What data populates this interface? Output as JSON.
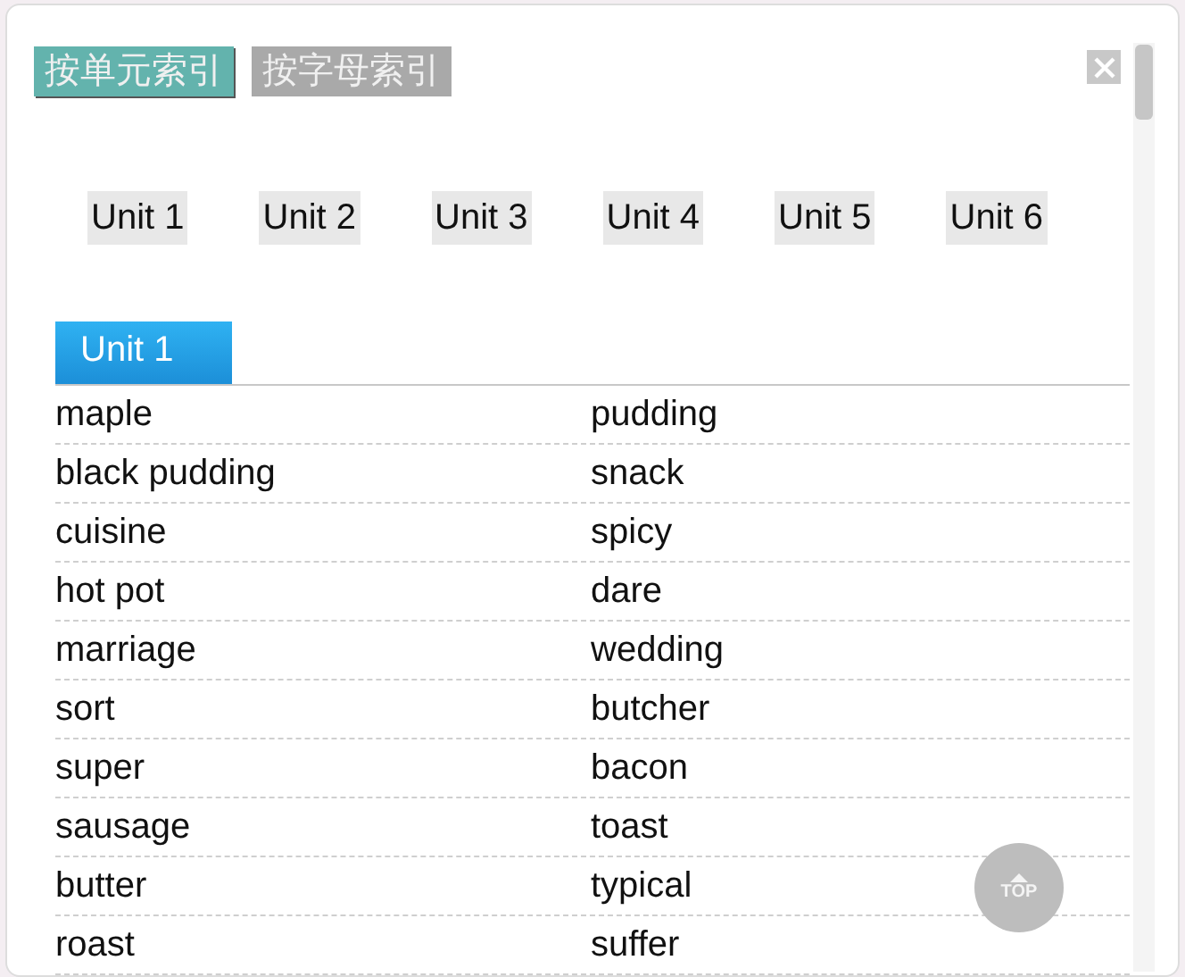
{
  "index_tabs": [
    {
      "label": "按单元索引",
      "selected": true
    },
    {
      "label": "按字母索引",
      "selected": false
    }
  ],
  "units": [
    {
      "label": "Unit 1"
    },
    {
      "label": "Unit 2"
    },
    {
      "label": "Unit 3"
    },
    {
      "label": "Unit 4"
    },
    {
      "label": "Unit 5"
    },
    {
      "label": "Unit 6"
    }
  ],
  "section": {
    "title": "Unit 1"
  },
  "words": [
    [
      "maple",
      "pudding"
    ],
    [
      "black pudding",
      "snack"
    ],
    [
      "cuisine",
      "spicy"
    ],
    [
      "hot pot",
      "dare"
    ],
    [
      "marriage",
      "wedding"
    ],
    [
      "sort",
      "butcher"
    ],
    [
      "super",
      "bacon"
    ],
    [
      "sausage",
      "toast"
    ],
    [
      "butter",
      "typical"
    ],
    [
      "roast",
      "suffer"
    ]
  ],
  "top_button": {
    "label": "TOP"
  }
}
